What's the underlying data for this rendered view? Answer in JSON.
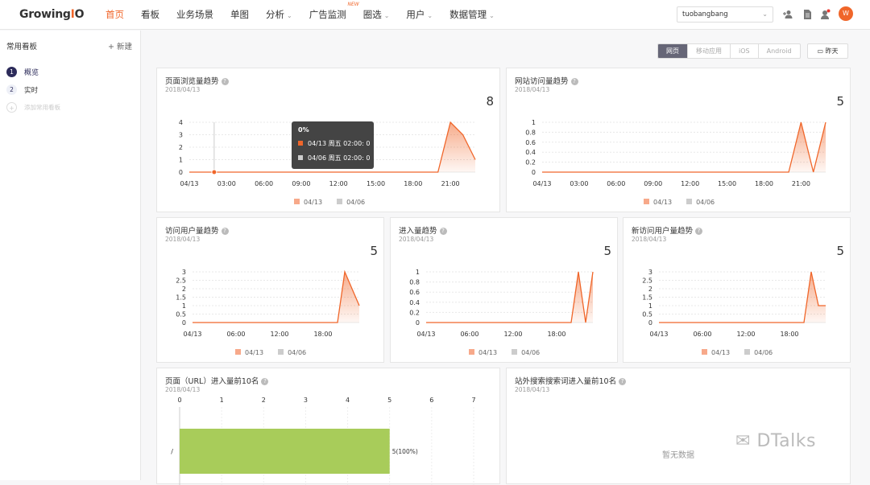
{
  "app": {
    "logo": "GrowingIO",
    "nav": [
      {
        "label": "首页",
        "active": true,
        "dropdown": false
      },
      {
        "label": "看板",
        "active": false,
        "dropdown": false
      },
      {
        "label": "业务场景",
        "active": false,
        "dropdown": false
      },
      {
        "label": "单图",
        "active": false,
        "dropdown": false
      },
      {
        "label": "分析",
        "active": false,
        "dropdown": true
      },
      {
        "label": "广告监测",
        "active": false,
        "dropdown": false,
        "badge": "NEW"
      },
      {
        "label": "圈选",
        "active": false,
        "dropdown": true
      },
      {
        "label": "用户",
        "active": false,
        "dropdown": true
      },
      {
        "label": "数据管理",
        "active": false,
        "dropdown": true
      }
    ],
    "project": "tuobangbang",
    "icons": [
      "add-user-icon",
      "document-icon",
      "notification-icon"
    ],
    "avatar_text": "W",
    "accent": "#f0662a"
  },
  "sidebar": {
    "title": "常用看板",
    "new_label": "+ 新建",
    "items": [
      {
        "num": "1",
        "label": "概览"
      },
      {
        "num": "2",
        "label": "实时"
      },
      {
        "num": "+",
        "label": "添加常用看板"
      }
    ]
  },
  "toolbar": {
    "segments": [
      "网页",
      "移动应用",
      "iOS",
      "Android"
    ],
    "active_segment": "网页",
    "date_label": "昨天"
  },
  "legend": {
    "current": "04/13",
    "previous": "04/06",
    "current_color": "#f0662a",
    "previous_color": "#cccccc"
  },
  "tooltip": {
    "title": "0%",
    "rows": [
      {
        "label": "04/13 周五 02:00: 0",
        "color": "#f0662a"
      },
      {
        "label": "04/06 周五 02:00: 0",
        "color": "#cccccc"
      }
    ]
  },
  "chart_data": [
    {
      "type": "area",
      "title": "页面浏览量趋势",
      "date": "2018/04/13",
      "total": "8",
      "x_ticks": [
        "04/13",
        "03:00",
        "06:00",
        "09:00",
        "12:00",
        "15:00",
        "18:00",
        "21:00"
      ],
      "y_ticks": [
        "0",
        "1",
        "2",
        "3",
        "4"
      ],
      "ylim": [
        0,
        4
      ],
      "series": [
        {
          "name": "04/13",
          "x": [
            0,
            1,
            2,
            3,
            4,
            5,
            6,
            7,
            8,
            9,
            10,
            11,
            12,
            13,
            14,
            15,
            16,
            17,
            18,
            19,
            20,
            21,
            22,
            23
          ],
          "values": [
            0,
            0,
            0,
            0,
            0,
            0,
            0,
            0,
            0,
            0,
            0,
            0,
            0,
            0,
            0,
            0,
            0,
            0,
            0,
            0,
            0,
            4,
            3,
            1
          ]
        },
        {
          "name": "04/06",
          "values": []
        }
      ]
    },
    {
      "type": "area",
      "title": "网站访问量趋势",
      "date": "2018/04/13",
      "total": "5",
      "x_ticks": [
        "04/13",
        "03:00",
        "06:00",
        "09:00",
        "12:00",
        "15:00",
        "18:00",
        "21:00"
      ],
      "y_ticks": [
        "0",
        "0.2",
        "0.4",
        "0.6",
        "0.8",
        "1"
      ],
      "ylim": [
        0,
        1
      ],
      "series": [
        {
          "name": "04/13",
          "x": [
            0,
            1,
            2,
            3,
            4,
            5,
            6,
            7,
            8,
            9,
            10,
            11,
            12,
            13,
            14,
            15,
            16,
            17,
            18,
            19,
            20,
            21,
            22,
            23
          ],
          "values": [
            0,
            0,
            0,
            0,
            0,
            0,
            0,
            0,
            0,
            0,
            0,
            0,
            0,
            0,
            0,
            0,
            0,
            0,
            0,
            0,
            0,
            1,
            0,
            1
          ]
        },
        {
          "name": "04/06",
          "values": []
        }
      ]
    },
    {
      "type": "area",
      "title": "访问用户量趋势",
      "date": "2018/04/13",
      "total": "5",
      "x_ticks": [
        "04/13",
        "06:00",
        "12:00",
        "18:00"
      ],
      "y_ticks": [
        "0",
        "0.5",
        "1",
        "1.5",
        "2",
        "2.5",
        "3"
      ],
      "ylim": [
        0,
        3
      ],
      "series": [
        {
          "name": "04/13",
          "x": [
            0,
            1,
            2,
            3,
            4,
            5,
            6,
            7,
            8,
            9,
            10,
            11,
            12,
            13,
            14,
            15,
            16,
            17,
            18,
            19,
            20,
            21,
            22,
            23
          ],
          "values": [
            0,
            0,
            0,
            0,
            0,
            0,
            0,
            0,
            0,
            0,
            0,
            0,
            0,
            0,
            0,
            0,
            0,
            0,
            0,
            0,
            0,
            3,
            2,
            1
          ]
        },
        {
          "name": "04/06",
          "values": []
        }
      ]
    },
    {
      "type": "area",
      "title": "进入量趋势",
      "date": "2018/04/13",
      "total": "5",
      "x_ticks": [
        "04/13",
        "06:00",
        "12:00",
        "18:00"
      ],
      "y_ticks": [
        "0",
        "0.2",
        "0.4",
        "0.6",
        "0.8",
        "1"
      ],
      "ylim": [
        0,
        1
      ],
      "series": [
        {
          "name": "04/13",
          "x": [
            0,
            1,
            2,
            3,
            4,
            5,
            6,
            7,
            8,
            9,
            10,
            11,
            12,
            13,
            14,
            15,
            16,
            17,
            18,
            19,
            20,
            21,
            22,
            23
          ],
          "values": [
            0,
            0,
            0,
            0,
            0,
            0,
            0,
            0,
            0,
            0,
            0,
            0,
            0,
            0,
            0,
            0,
            0,
            0,
            0,
            0,
            0,
            1,
            0,
            1
          ]
        },
        {
          "name": "04/06",
          "values": []
        }
      ]
    },
    {
      "type": "area",
      "title": "新访问用户量趋势",
      "date": "2018/04/13",
      "total": "5",
      "x_ticks": [
        "04/13",
        "06:00",
        "12:00",
        "18:00"
      ],
      "y_ticks": [
        "0",
        "0.5",
        "1",
        "1.5",
        "2",
        "2.5",
        "3"
      ],
      "ylim": [
        0,
        3
      ],
      "series": [
        {
          "name": "04/13",
          "x": [
            0,
            1,
            2,
            3,
            4,
            5,
            6,
            7,
            8,
            9,
            10,
            11,
            12,
            13,
            14,
            15,
            16,
            17,
            18,
            19,
            20,
            21,
            22,
            23
          ],
          "values": [
            0,
            0,
            0,
            0,
            0,
            0,
            0,
            0,
            0,
            0,
            0,
            0,
            0,
            0,
            0,
            0,
            0,
            0,
            0,
            0,
            0,
            3,
            1,
            1
          ]
        },
        {
          "name": "04/06",
          "values": []
        }
      ]
    },
    {
      "type": "bar",
      "title": "页面（URL）进入量前10名",
      "date": "2018/04/13",
      "orientation": "horizontal",
      "x_ticks": [
        "0",
        "1",
        "2",
        "3",
        "4",
        "5",
        "6",
        "7"
      ],
      "xlim": [
        0,
        7
      ],
      "categories": [
        "/"
      ],
      "values": [
        5
      ],
      "data_labels": [
        "5(100%)"
      ],
      "color": "#a8cc5a"
    }
  ],
  "search_card": {
    "title": "站外搜索搜索词进入量前10名",
    "date": "2018/04/13",
    "empty_text": "暂无数据"
  },
  "watermark": "DTalks"
}
